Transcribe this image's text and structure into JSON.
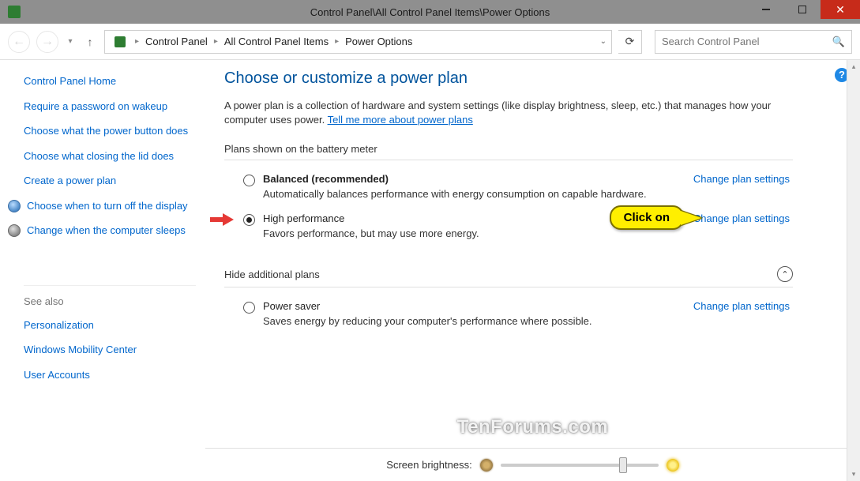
{
  "titlebar": {
    "title": "Control Panel\\All Control Panel Items\\Power Options"
  },
  "breadcrumb": {
    "items": [
      "Control Panel",
      "All Control Panel Items",
      "Power Options"
    ]
  },
  "search": {
    "placeholder": "Search Control Panel"
  },
  "sidebar": {
    "home": "Control Panel Home",
    "links": [
      "Require a password on wakeup",
      "Choose what the power button does",
      "Choose what closing the lid does",
      "Create a power plan",
      "Choose when to turn off the display",
      "Change when the computer sleeps"
    ],
    "see_also_header": "See also",
    "see_also": [
      "Personalization",
      "Windows Mobility Center",
      "User Accounts"
    ]
  },
  "main": {
    "title": "Choose or customize a power plan",
    "desc_prefix": "A power plan is a collection of hardware and system settings (like display brightness, sleep, etc.) that manages how your computer uses power. ",
    "desc_link": "Tell me more about power plans",
    "section1": "Plans shown on the battery meter",
    "section2": "Hide additional plans",
    "plans": [
      {
        "name": "Balanced (recommended)",
        "desc": "Automatically balances performance with energy consumption on capable hardware.",
        "link": "Change plan settings",
        "selected": false,
        "bold": true
      },
      {
        "name": "High performance",
        "desc": "Favors performance, but may use more energy.",
        "link": "Change plan settings",
        "selected": true,
        "bold": false
      }
    ],
    "additional_plans": [
      {
        "name": "Power saver",
        "desc": "Saves energy by reducing your computer's performance where possible.",
        "link": "Change plan settings",
        "selected": false,
        "bold": false
      }
    ],
    "brightness_label": "Screen brightness:"
  },
  "annotation": {
    "callout": "Click on"
  },
  "watermark": "TenForums.com"
}
